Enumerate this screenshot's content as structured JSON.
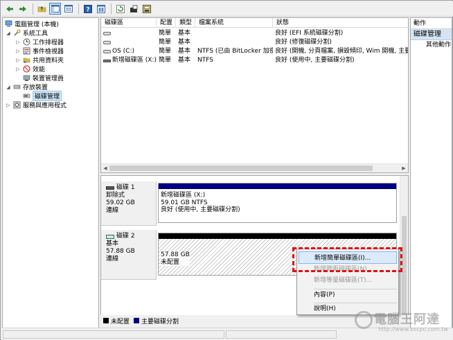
{
  "tree": {
    "items": [
      {
        "label": "電腦管理 (本機)",
        "level": 0,
        "expander": ""
      },
      {
        "label": "系統工具",
        "level": 1,
        "expander": "◢"
      },
      {
        "label": "工作排程器",
        "level": 2,
        "expander": "▷"
      },
      {
        "label": "事件檢視器",
        "level": 2,
        "expander": "▷"
      },
      {
        "label": "共用資料夾",
        "level": 2,
        "expander": "▷"
      },
      {
        "label": "效能",
        "level": 2,
        "expander": "▷"
      },
      {
        "label": "裝置管理員",
        "level": 2,
        "expander": ""
      },
      {
        "label": "存放裝置",
        "level": 1,
        "expander": "◢"
      },
      {
        "label": "磁碟管理",
        "level": 2,
        "expander": "",
        "selected": true
      },
      {
        "label": "服務與應用程式",
        "level": 1,
        "expander": "▷"
      }
    ]
  },
  "volumes": {
    "columns": [
      "磁碟區",
      "配置",
      "類型",
      "檔案系統",
      "狀態"
    ],
    "rows": [
      {
        "name": "",
        "layout": "簡單",
        "type": "基本",
        "fs": "",
        "status": "良好 (EFI 系統磁碟分割)"
      },
      {
        "name": "",
        "layout": "簡單",
        "type": "基本",
        "fs": "",
        "status": "良好 (修復磁碟分割)"
      },
      {
        "name": "OS (C:)",
        "layout": "簡單",
        "type": "基本",
        "fs": "NTFS (已由 BitLocker 加密)",
        "status": "良好 (開機, 分頁檔案, 損毀傾印, Wim 開機, 主要"
      },
      {
        "name": "新增磁碟區 (X:)",
        "layout": "簡單",
        "type": "基本",
        "fs": "NTFS",
        "status": "良好 (使用中, 主要磁碟分割)"
      }
    ]
  },
  "disks": [
    {
      "name": "磁碟 1",
      "kind": "卸除式",
      "size": "59.02 GB",
      "state": "連線",
      "partition": {
        "line1": "新增磁碟區 (X:)",
        "line2": "59.01 GB NTFS",
        "line3": "良好 (使用中, 主要磁碟分割)"
      }
    },
    {
      "name": "磁碟 2",
      "kind": "基本",
      "size": "57.88 GB",
      "state": "連線",
      "partition": {
        "line1": "57.88 GB",
        "line2": "未配置",
        "line3": ""
      }
    }
  ],
  "legend": {
    "unallocated": "未配置",
    "primary": "主要磁碟分割"
  },
  "actions": {
    "header": "動作",
    "section": "磁碟管理",
    "item": "其他動作"
  },
  "context_menu": {
    "items": [
      {
        "label": "新增簡單磁碟區(I)...",
        "state": "highlighted"
      },
      {
        "label": "新增跨距磁碟區(N)...",
        "state": "disabled"
      },
      {
        "label": "新增等量磁碟區(T)...",
        "state": "disabled"
      },
      {
        "label": "內容(P)",
        "state": "normal"
      },
      {
        "label": "說明(H)",
        "state": "normal"
      }
    ]
  },
  "watermark": {
    "text": "電腦王阿達",
    "url": "http://www.kocpc.com.tw"
  },
  "colors": {
    "primary_partition": "#000080",
    "unallocated": "#000000",
    "selection": "#cce4f7",
    "highlight": "#e01010"
  }
}
